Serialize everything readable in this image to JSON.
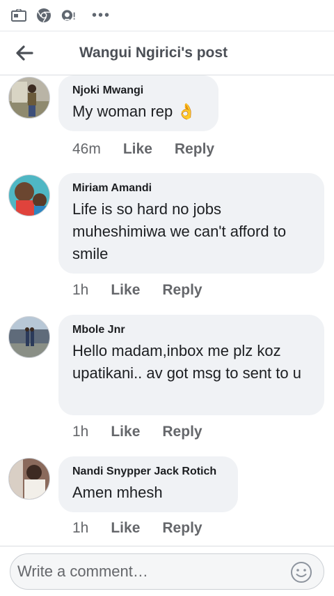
{
  "status_bar": {
    "icons": [
      "sim-card-icon",
      "chrome-icon",
      "alert-app-icon"
    ],
    "more": "•••"
  },
  "header": {
    "title": "Wangui Ngirici's post",
    "back_icon": "arrow-left-icon"
  },
  "comments": [
    {
      "author": "Njoki Mwangi",
      "text": "My woman rep 👌",
      "time": "46m",
      "like_label": "Like",
      "reply_label": "Reply"
    },
    {
      "author": "Miriam Amandi",
      "text": "Life is so hard no jobs muheshimiwa we can't afford to smile",
      "time": "1h",
      "like_label": "Like",
      "reply_label": "Reply"
    },
    {
      "author": "Mbole Jnr",
      "text": "Hello madam,inbox me plz koz upatikani.. av got msg to sent to u",
      "time": "1h",
      "like_label": "Like",
      "reply_label": "Reply"
    },
    {
      "author": "Nandi Snypper Jack Rotich",
      "text": "Amen mhesh",
      "time": "1h",
      "like_label": "Like",
      "reply_label": "Reply"
    }
  ],
  "composer": {
    "placeholder": "Write a comment…",
    "emoji_icon": "smiley-icon"
  },
  "colors": {
    "bubble_bg": "#f0f2f5",
    "meta_text": "#65676b",
    "header_text": "#4b4f56"
  }
}
